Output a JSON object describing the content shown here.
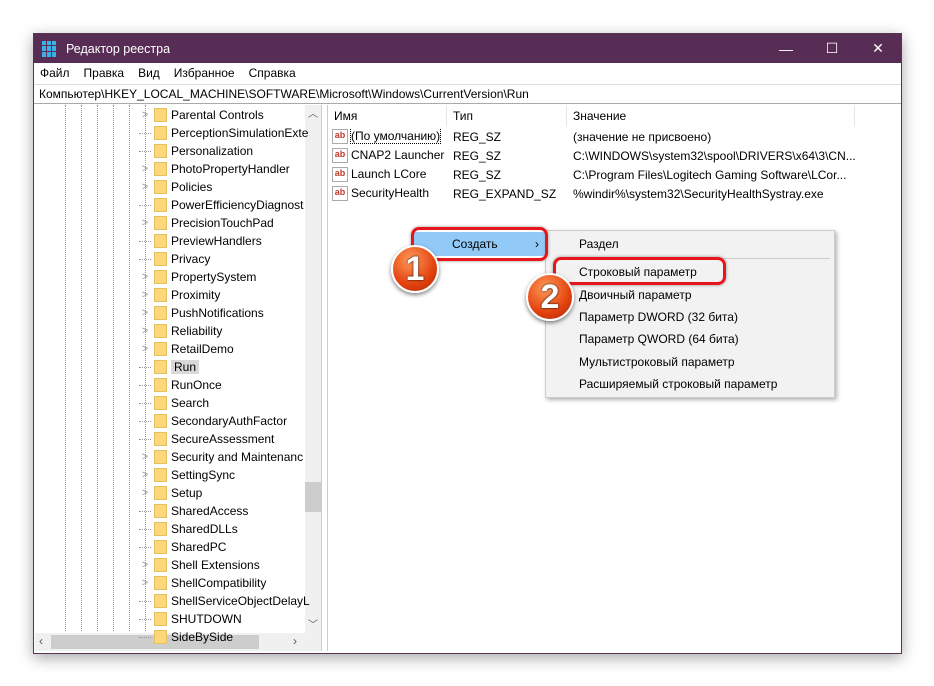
{
  "window": {
    "title": "Редактор реестра",
    "minimize": "—",
    "maximize": "☐",
    "close": "✕"
  },
  "menubar": [
    "Файл",
    "Правка",
    "Вид",
    "Избранное",
    "Справка"
  ],
  "address": "Компьютер\\HKEY_LOCAL_MACHINE\\SOFTWARE\\Microsoft\\Windows\\CurrentVersion\\Run",
  "tree": [
    {
      "label": "Parental Controls",
      "expandable": true
    },
    {
      "label": "PerceptionSimulationExte",
      "expandable": false
    },
    {
      "label": "Personalization",
      "expandable": false
    },
    {
      "label": "PhotoPropertyHandler",
      "expandable": true
    },
    {
      "label": "Policies",
      "expandable": true
    },
    {
      "label": "PowerEfficiencyDiagnost",
      "expandable": false
    },
    {
      "label": "PrecisionTouchPad",
      "expandable": true
    },
    {
      "label": "PreviewHandlers",
      "expandable": false
    },
    {
      "label": "Privacy",
      "expandable": false
    },
    {
      "label": "PropertySystem",
      "expandable": true
    },
    {
      "label": "Proximity",
      "expandable": true
    },
    {
      "label": "PushNotifications",
      "expandable": true
    },
    {
      "label": "Reliability",
      "expandable": true
    },
    {
      "label": "RetailDemo",
      "expandable": true
    },
    {
      "label": "Run",
      "expandable": false,
      "selected": true
    },
    {
      "label": "RunOnce",
      "expandable": false
    },
    {
      "label": "Search",
      "expandable": false
    },
    {
      "label": "SecondaryAuthFactor",
      "expandable": false
    },
    {
      "label": "SecureAssessment",
      "expandable": false
    },
    {
      "label": "Security and Maintenanc",
      "expandable": true
    },
    {
      "label": "SettingSync",
      "expandable": true
    },
    {
      "label": "Setup",
      "expandable": true
    },
    {
      "label": "SharedAccess",
      "expandable": false
    },
    {
      "label": "SharedDLLs",
      "expandable": false
    },
    {
      "label": "SharedPC",
      "expandable": false
    },
    {
      "label": "Shell Extensions",
      "expandable": true
    },
    {
      "label": "ShellCompatibility",
      "expandable": true
    },
    {
      "label": "ShellServiceObjectDelayL",
      "expandable": false
    },
    {
      "label": "SHUTDOWN",
      "expandable": false
    },
    {
      "label": "SideBySide",
      "expandable": false
    }
  ],
  "columns": {
    "name": "Имя",
    "type": "Тип",
    "value": "Значение"
  },
  "values": [
    {
      "name": "(По умолчанию)",
      "type": "REG_SZ",
      "data": "(значение не присвоено)"
    },
    {
      "name": "CNAP2 Launcher",
      "type": "REG_SZ",
      "data": "C:\\WINDOWS\\system32\\spool\\DRIVERS\\x64\\3\\CN..."
    },
    {
      "name": "Launch LCore",
      "type": "REG_SZ",
      "data": "C:\\Program Files\\Logitech Gaming Software\\LCor..."
    },
    {
      "name": "SecurityHealth",
      "type": "REG_EXPAND_SZ",
      "data": "%windir%\\system32\\SecurityHealthSystray.exe"
    }
  ],
  "context_menu": {
    "create": "Создать",
    "arrow": "›"
  },
  "submenu": [
    "Раздел",
    "Строковый параметр",
    "Двоичный параметр",
    "Параметр DWORD (32 бита)",
    "Параметр QWORD (64 бита)",
    "Мультистроковый параметр",
    "Расширяемый строковый параметр"
  ],
  "badges": [
    "1",
    "2"
  ],
  "colors": {
    "titlebar": "#572d56",
    "menu_highlight": "#91c9f7",
    "annotation": "#e8161b"
  }
}
